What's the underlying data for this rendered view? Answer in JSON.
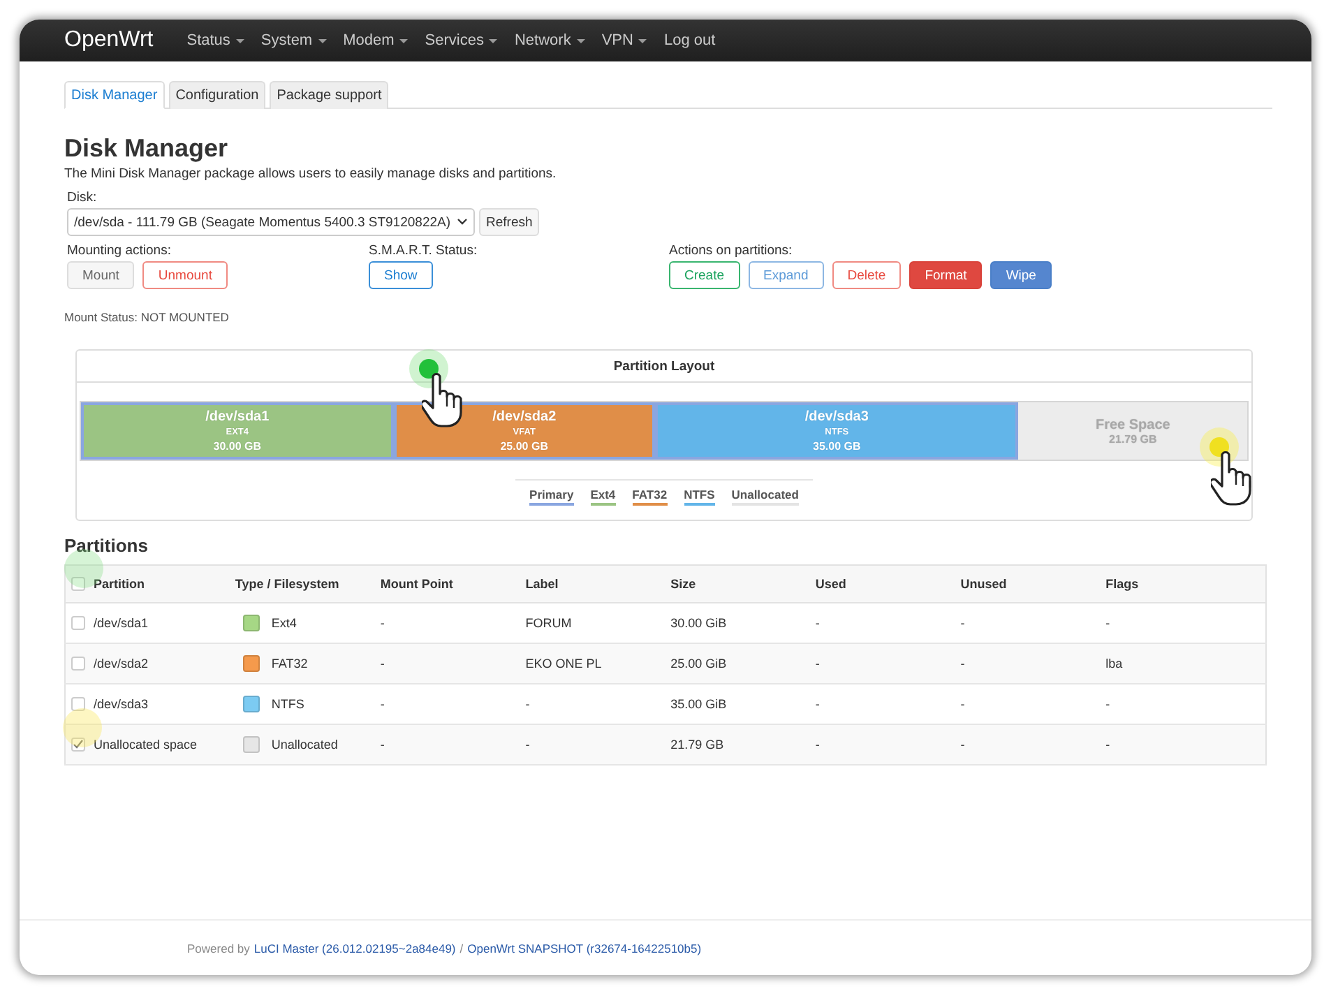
{
  "nav": {
    "brand": "OpenWrt",
    "menus": [
      {
        "label": "Status",
        "dropdown": true
      },
      {
        "label": "System",
        "dropdown": true
      },
      {
        "label": "Modem",
        "dropdown": true
      },
      {
        "label": "Services",
        "dropdown": true
      },
      {
        "label": "Network",
        "dropdown": true
      },
      {
        "label": "VPN",
        "dropdown": true
      },
      {
        "label": "Log out",
        "dropdown": false
      }
    ]
  },
  "tabs": [
    {
      "label": "Disk Manager",
      "selected": true
    },
    {
      "label": "Configuration",
      "selected": false
    },
    {
      "label": "Package support",
      "selected": false
    }
  ],
  "page": {
    "title": "Disk Manager",
    "description": "The Mini Disk Manager package allows users to easily manage disks and partitions."
  },
  "disk": {
    "label": "Disk:",
    "value": "/dev/sda - 111.79 GB (Seagate Momentus 5400.3 ST9120822A)",
    "refresh": "Refresh"
  },
  "action_groups": [
    {
      "label": "Mounting actions:",
      "buttons": [
        {
          "label": "Mount",
          "kind": "default"
        },
        {
          "label": "Unmount",
          "kind": "remove"
        }
      ]
    },
    {
      "label": "S.M.A.R.T. Status:",
      "buttons": [
        {
          "label": "Show",
          "kind": "show"
        }
      ]
    },
    {
      "label": "Actions on partitions:",
      "buttons": [
        {
          "label": "Create",
          "kind": "add"
        },
        {
          "label": "Expand",
          "kind": "expand"
        },
        {
          "label": "Delete",
          "kind": "remove"
        },
        {
          "label": "Format",
          "kind": "danger"
        },
        {
          "label": "Wipe",
          "kind": "apply"
        }
      ]
    }
  ],
  "mount_status": {
    "label": "Mount Status:",
    "value": "NOT MOUNTED"
  },
  "partition_layout": {
    "title": "Partition Layout",
    "segments": [
      {
        "kind": "partition",
        "name": "/dev/sda1",
        "fs": "EXT4",
        "size": "30.00 GB",
        "color": "#9bc483"
      },
      {
        "kind": "partition",
        "name": "/dev/sda2",
        "fs": "VFAT",
        "size": "25.00 GB",
        "color": "#e08e48"
      },
      {
        "kind": "partition",
        "name": "/dev/sda3",
        "fs": "NTFS",
        "size": "35.00 GB",
        "color": "#62b5e9"
      },
      {
        "kind": "free",
        "name": "Free Space",
        "size": "21.79 GB",
        "color": "#ececec"
      }
    ],
    "legend": [
      {
        "label": "Primary",
        "color": "#8aa6e0"
      },
      {
        "label": "Ext4",
        "color": "#9bc483"
      },
      {
        "label": "FAT32",
        "color": "#e08e48"
      },
      {
        "label": "NTFS",
        "color": "#62b5e9"
      },
      {
        "label": "Unallocated",
        "color": "#e4e4e4"
      }
    ]
  },
  "partitions": {
    "title": "Partitions",
    "header_checked": false,
    "columns": [
      "Partition",
      "Type / Filesystem",
      "Mount Point",
      "Label",
      "Size",
      "Used",
      "Unused",
      "Flags"
    ],
    "rows": [
      {
        "checked": false,
        "partition": "/dev/sda1",
        "type": "Ext4",
        "color": "#a6d785",
        "mount_point": "-",
        "label": "FORUM",
        "size": "30.00 GiB",
        "used": "-",
        "unused": "-",
        "flags": "-"
      },
      {
        "checked": false,
        "partition": "/dev/sda2",
        "type": "FAT32",
        "color": "#f59a4c",
        "mount_point": "-",
        "label": "EKO ONE PL",
        "size": "25.00 GiB",
        "used": "-",
        "unused": "-",
        "flags": "lba"
      },
      {
        "checked": false,
        "partition": "/dev/sda3",
        "type": "NTFS",
        "color": "#7ccbf2",
        "mount_point": "-",
        "label": "-",
        "size": "35.00 GiB",
        "used": "-",
        "unused": "-",
        "flags": "-"
      },
      {
        "checked": true,
        "partition": "Unallocated space",
        "type": "Unallocated",
        "color": "#e6e6e6",
        "mount_point": "-",
        "label": "-",
        "size": "21.79 GB",
        "used": "-",
        "unused": "-",
        "flags": "-"
      }
    ]
  },
  "footer": {
    "prefix": "Powered by",
    "link1": "LuCI Master (26.012.02195~2a84e49)",
    "separator": "/",
    "link2": "OpenWrt SNAPSHOT (r32674-16422510b5)"
  }
}
